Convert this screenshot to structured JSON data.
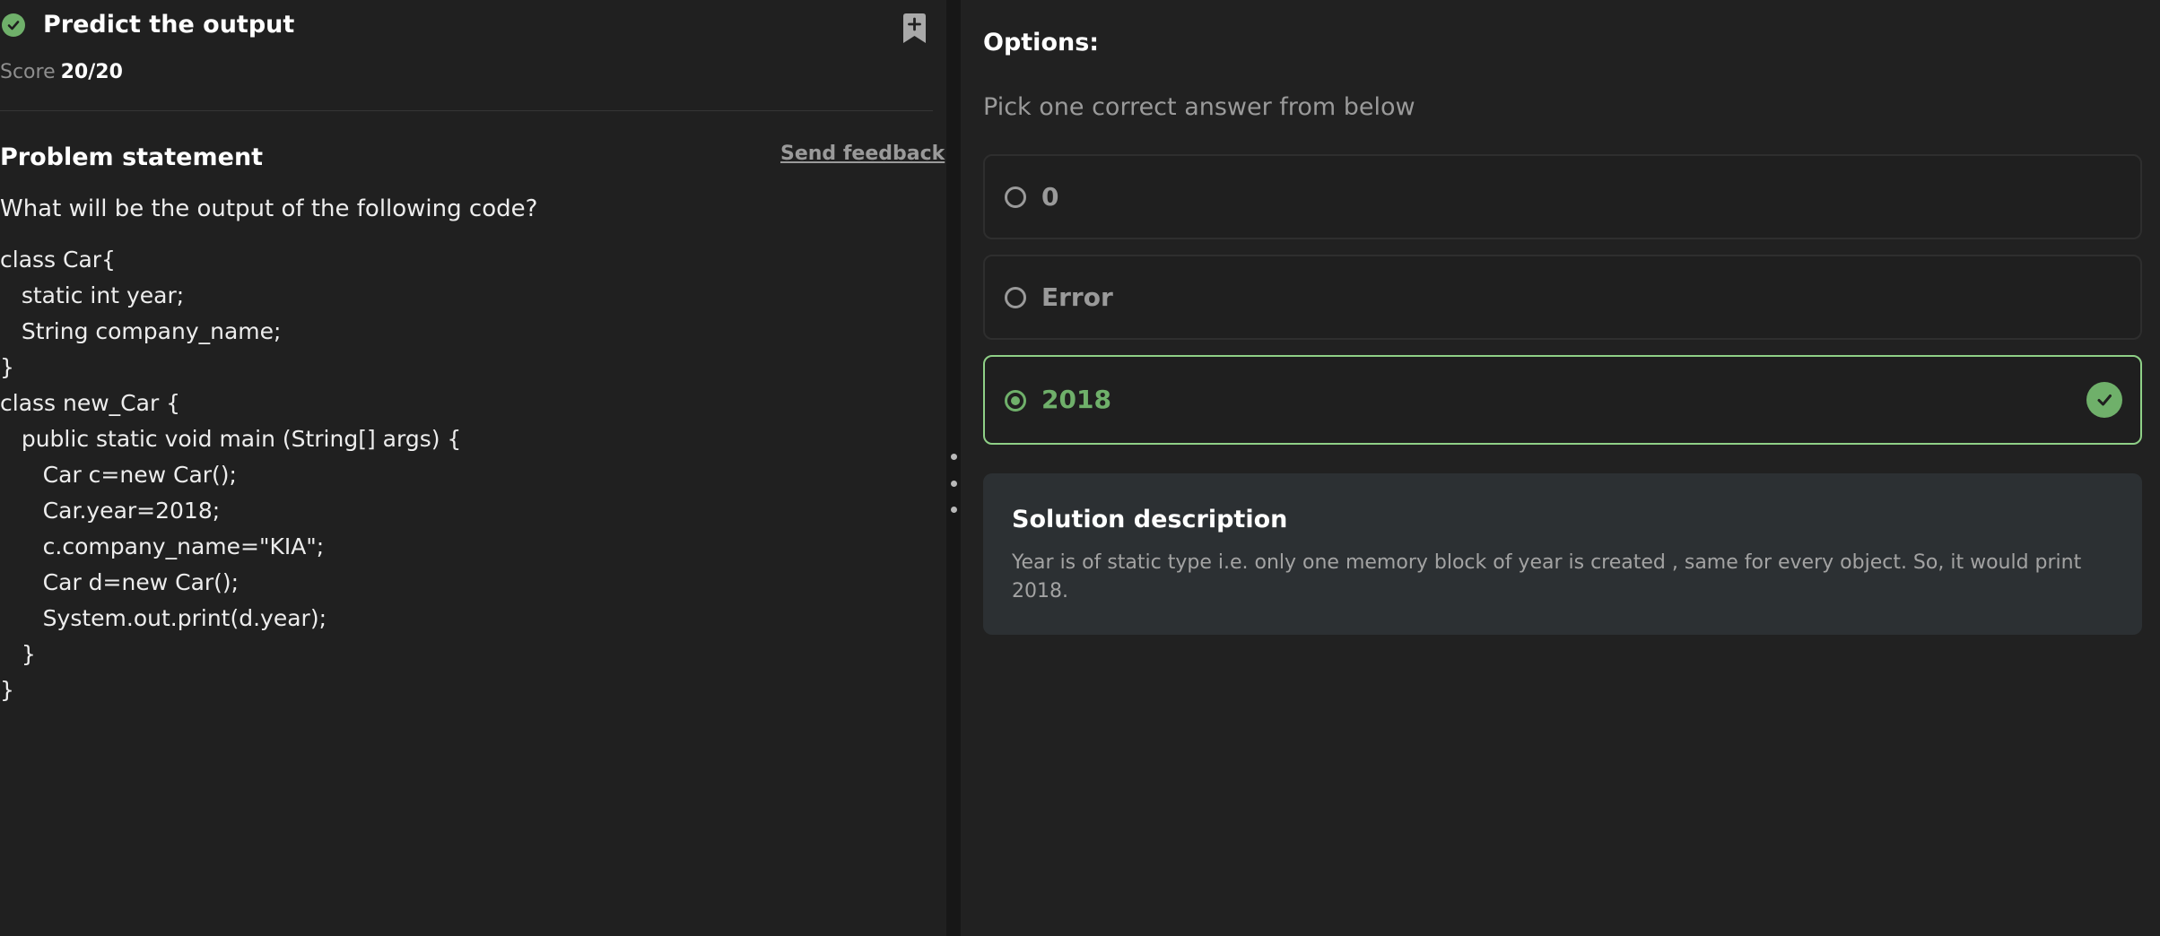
{
  "question": {
    "title": "Predict the output",
    "score_label": "Score",
    "score_value": "20/20",
    "status": "completed"
  },
  "problem": {
    "heading": "Problem statement",
    "feedback_link": "Send feedback",
    "question_text": "What will be the output of the following code?",
    "code_lines": [
      "class Car{",
      "   static int year;",
      "   String company_name;",
      "}",
      "class new_Car {",
      "   public static void main (String[] args) {",
      "      Car c=new Car();",
      "      Car.year=2018;",
      "      c.company_name=\"KIA\";",
      "      Car d=new Car();",
      "      System.out.print(d.year);",
      "   }",
      "}"
    ]
  },
  "options": {
    "title": "Options:",
    "instruction": "Pick one correct answer from below",
    "items": [
      {
        "label": "0",
        "selected": false,
        "correct": false
      },
      {
        "label": "Error",
        "selected": false,
        "correct": false
      },
      {
        "label": "2018",
        "selected": true,
        "correct": true
      }
    ]
  },
  "solution": {
    "title": "Solution description",
    "text": "Year is of static type i.e. only one memory block of year is created , same for every object. So, it would print 2018."
  },
  "icons": {
    "status": "check-circle-icon",
    "bookmark": "bookmark-add-icon",
    "correct": "check-circle-icon",
    "splitter": "drag-handle-icon"
  },
  "colors": {
    "accent_green": "#6fb06a",
    "selected_border": "#8fd087",
    "background": "#1f1f1f",
    "solution_bg": "#2c3033"
  }
}
